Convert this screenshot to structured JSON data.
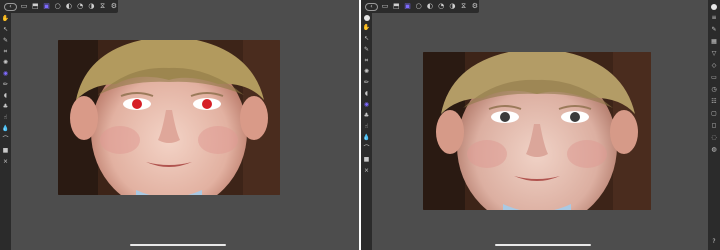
{
  "panels": [
    {
      "id": "before",
      "topbar": {
        "back_glyph": "‹",
        "icons": [
          "document-icon",
          "export-icon",
          "persona-icon",
          "circle-icon",
          "adjust-icon",
          "history-icon",
          "contrast-icon",
          "split-icon",
          "settings-icon"
        ]
      },
      "photo": {
        "subject": "child-portrait",
        "eye_color": "#d61e26",
        "red_eye": true
      }
    },
    {
      "id": "after",
      "topbar": {
        "back_glyph": "‹",
        "icons": [
          "document-icon",
          "export-icon",
          "persona-icon",
          "circle-icon",
          "adjust-icon",
          "history-icon",
          "contrast-icon",
          "split-icon",
          "settings-icon"
        ]
      },
      "photo": {
        "subject": "child-portrait",
        "eye_color": "#3a3a3a",
        "red_eye": false
      }
    }
  ],
  "right_toolbar": {
    "help_glyph": "?"
  },
  "colors": {
    "canvas_bg": "#4d4d4d",
    "toolbar_bg": "#2b2b2b",
    "accent": "#7e6bff"
  }
}
